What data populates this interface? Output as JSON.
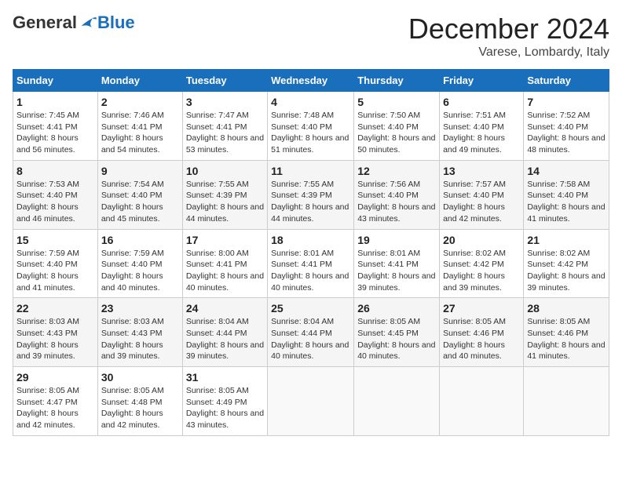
{
  "header": {
    "logo_general": "General",
    "logo_blue": "Blue",
    "month_title": "December 2024",
    "location": "Varese, Lombardy, Italy"
  },
  "days_of_week": [
    "Sunday",
    "Monday",
    "Tuesday",
    "Wednesday",
    "Thursday",
    "Friday",
    "Saturday"
  ],
  "weeks": [
    [
      {
        "day": 1,
        "sunrise": "7:45 AM",
        "sunset": "4:41 PM",
        "daylight": "8 hours and 56 minutes."
      },
      {
        "day": 2,
        "sunrise": "7:46 AM",
        "sunset": "4:41 PM",
        "daylight": "8 hours and 54 minutes."
      },
      {
        "day": 3,
        "sunrise": "7:47 AM",
        "sunset": "4:41 PM",
        "daylight": "8 hours and 53 minutes."
      },
      {
        "day": 4,
        "sunrise": "7:48 AM",
        "sunset": "4:40 PM",
        "daylight": "8 hours and 51 minutes."
      },
      {
        "day": 5,
        "sunrise": "7:50 AM",
        "sunset": "4:40 PM",
        "daylight": "8 hours and 50 minutes."
      },
      {
        "day": 6,
        "sunrise": "7:51 AM",
        "sunset": "4:40 PM",
        "daylight": "8 hours and 49 minutes."
      },
      {
        "day": 7,
        "sunrise": "7:52 AM",
        "sunset": "4:40 PM",
        "daylight": "8 hours and 48 minutes."
      }
    ],
    [
      {
        "day": 8,
        "sunrise": "7:53 AM",
        "sunset": "4:40 PM",
        "daylight": "8 hours and 46 minutes."
      },
      {
        "day": 9,
        "sunrise": "7:54 AM",
        "sunset": "4:40 PM",
        "daylight": "8 hours and 45 minutes."
      },
      {
        "day": 10,
        "sunrise": "7:55 AM",
        "sunset": "4:39 PM",
        "daylight": "8 hours and 44 minutes."
      },
      {
        "day": 11,
        "sunrise": "7:55 AM",
        "sunset": "4:39 PM",
        "daylight": "8 hours and 44 minutes."
      },
      {
        "day": 12,
        "sunrise": "7:56 AM",
        "sunset": "4:40 PM",
        "daylight": "8 hours and 43 minutes."
      },
      {
        "day": 13,
        "sunrise": "7:57 AM",
        "sunset": "4:40 PM",
        "daylight": "8 hours and 42 minutes."
      },
      {
        "day": 14,
        "sunrise": "7:58 AM",
        "sunset": "4:40 PM",
        "daylight": "8 hours and 41 minutes."
      }
    ],
    [
      {
        "day": 15,
        "sunrise": "7:59 AM",
        "sunset": "4:40 PM",
        "daylight": "8 hours and 41 minutes."
      },
      {
        "day": 16,
        "sunrise": "7:59 AM",
        "sunset": "4:40 PM",
        "daylight": "8 hours and 40 minutes."
      },
      {
        "day": 17,
        "sunrise": "8:00 AM",
        "sunset": "4:41 PM",
        "daylight": "8 hours and 40 minutes."
      },
      {
        "day": 18,
        "sunrise": "8:01 AM",
        "sunset": "4:41 PM",
        "daylight": "8 hours and 40 minutes."
      },
      {
        "day": 19,
        "sunrise": "8:01 AM",
        "sunset": "4:41 PM",
        "daylight": "8 hours and 39 minutes."
      },
      {
        "day": 20,
        "sunrise": "8:02 AM",
        "sunset": "4:42 PM",
        "daylight": "8 hours and 39 minutes."
      },
      {
        "day": 21,
        "sunrise": "8:02 AM",
        "sunset": "4:42 PM",
        "daylight": "8 hours and 39 minutes."
      }
    ],
    [
      {
        "day": 22,
        "sunrise": "8:03 AM",
        "sunset": "4:43 PM",
        "daylight": "8 hours and 39 minutes."
      },
      {
        "day": 23,
        "sunrise": "8:03 AM",
        "sunset": "4:43 PM",
        "daylight": "8 hours and 39 minutes."
      },
      {
        "day": 24,
        "sunrise": "8:04 AM",
        "sunset": "4:44 PM",
        "daylight": "8 hours and 39 minutes."
      },
      {
        "day": 25,
        "sunrise": "8:04 AM",
        "sunset": "4:44 PM",
        "daylight": "8 hours and 40 minutes."
      },
      {
        "day": 26,
        "sunrise": "8:05 AM",
        "sunset": "4:45 PM",
        "daylight": "8 hours and 40 minutes."
      },
      {
        "day": 27,
        "sunrise": "8:05 AM",
        "sunset": "4:46 PM",
        "daylight": "8 hours and 40 minutes."
      },
      {
        "day": 28,
        "sunrise": "8:05 AM",
        "sunset": "4:46 PM",
        "daylight": "8 hours and 41 minutes."
      }
    ],
    [
      {
        "day": 29,
        "sunrise": "8:05 AM",
        "sunset": "4:47 PM",
        "daylight": "8 hours and 42 minutes."
      },
      {
        "day": 30,
        "sunrise": "8:05 AM",
        "sunset": "4:48 PM",
        "daylight": "8 hours and 42 minutes."
      },
      {
        "day": 31,
        "sunrise": "8:05 AM",
        "sunset": "4:49 PM",
        "daylight": "8 hours and 43 minutes."
      },
      null,
      null,
      null,
      null
    ]
  ]
}
